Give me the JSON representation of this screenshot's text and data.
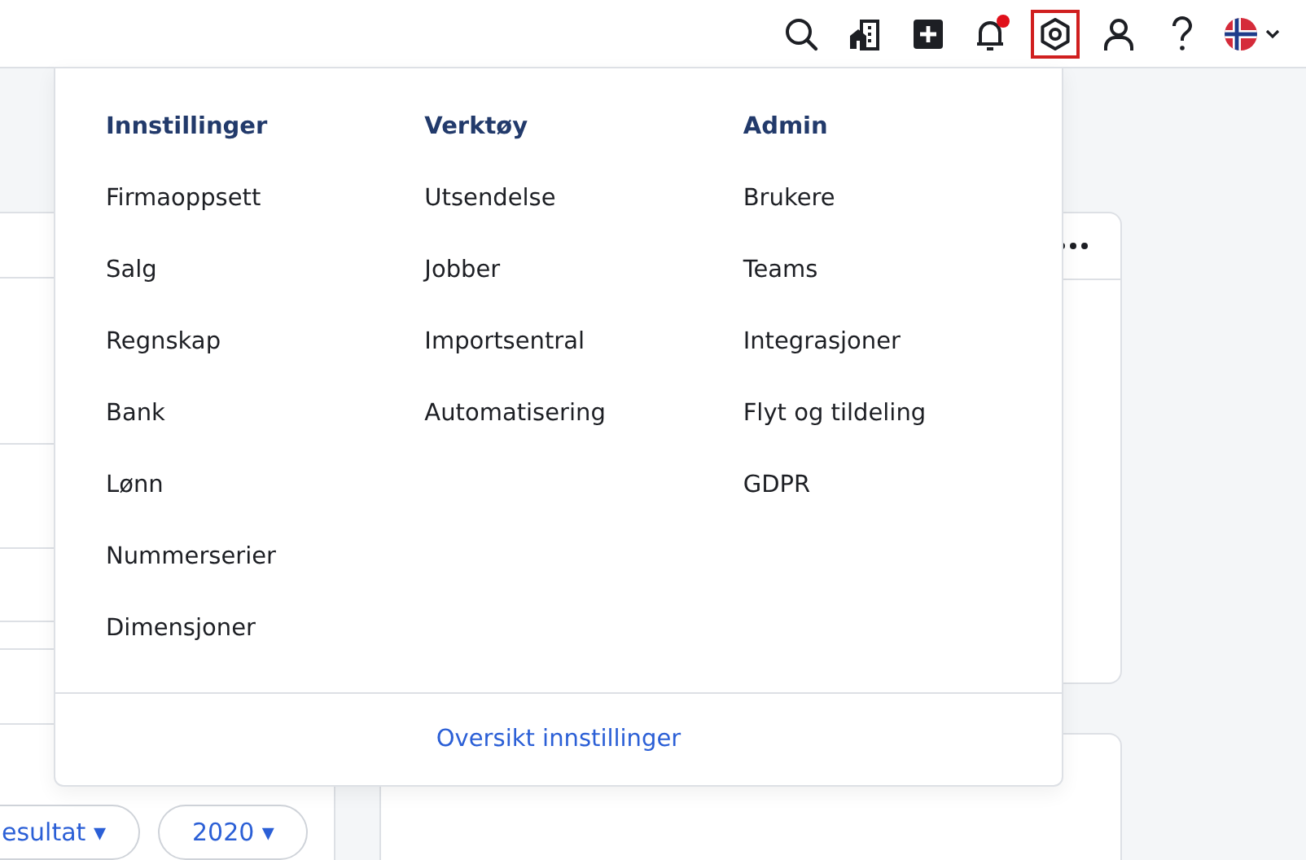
{
  "topbar": {
    "icons": [
      {
        "kind": "search",
        "selected": false
      },
      {
        "kind": "company",
        "selected": false
      },
      {
        "kind": "add",
        "selected": false
      },
      {
        "kind": "bell",
        "selected": false,
        "dot": true
      },
      {
        "kind": "settings",
        "selected": true
      },
      {
        "kind": "user",
        "selected": false
      },
      {
        "kind": "help",
        "selected": false
      },
      {
        "kind": "language",
        "selected": false
      }
    ]
  },
  "background": {
    "filters": [
      "esultat ▾",
      "2020 ▾"
    ]
  },
  "menu": {
    "columns": [
      {
        "title": "Innstillinger",
        "items": [
          "Firmaoppsett",
          "Salg",
          "Regnskap",
          "Bank",
          "Lønn",
          "Nummerserier",
          "Dimensjoner"
        ]
      },
      {
        "title": "Verktøy",
        "items": [
          "Utsendelse",
          "Jobber",
          "Importsentral",
          "Automatisering"
        ]
      },
      {
        "title": "Admin",
        "items": [
          "Brukere",
          "Teams",
          "Integrasjoner",
          "Flyt og tildeling",
          "GDPR"
        ]
      }
    ],
    "footer_link": "Oversikt innstillinger"
  }
}
